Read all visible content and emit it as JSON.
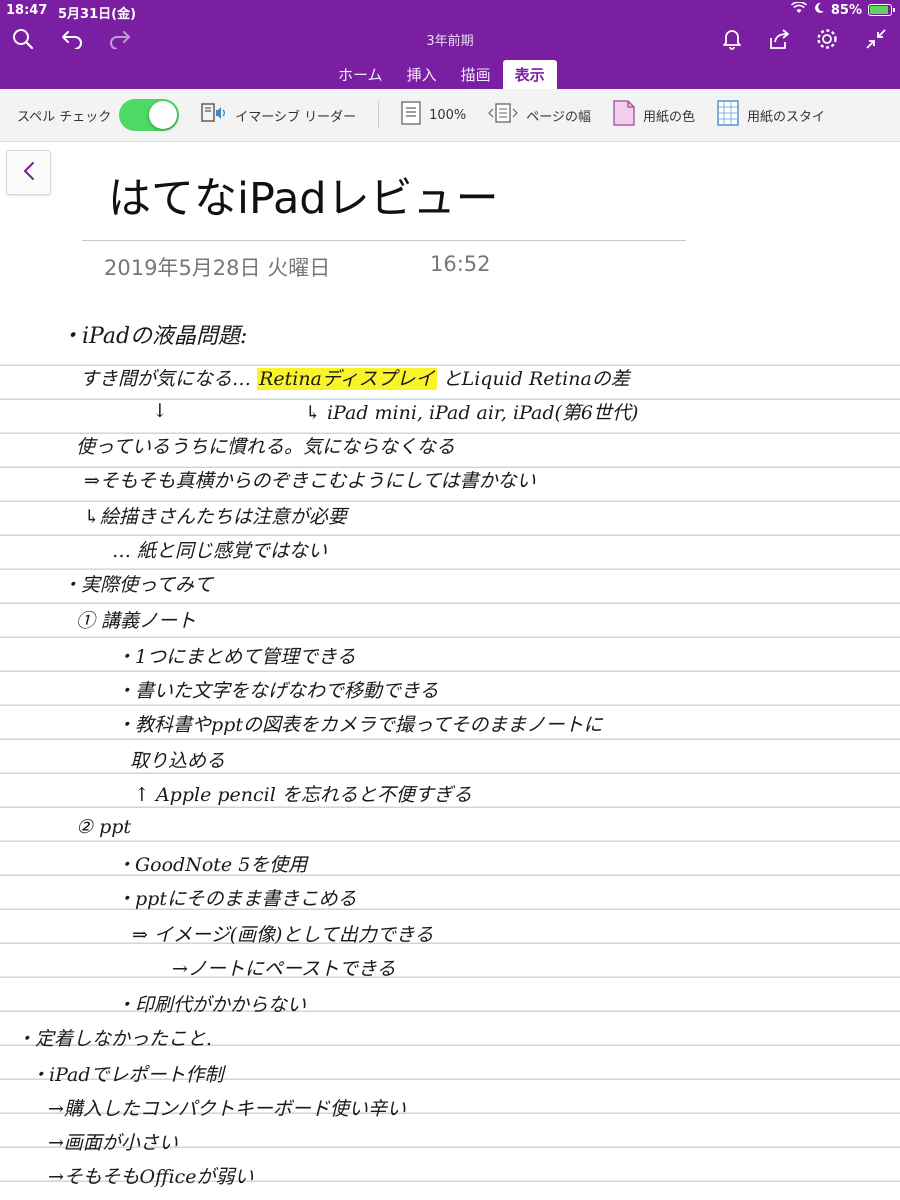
{
  "status": {
    "time": "18:47",
    "date": "5月31日(金)",
    "battery": "85%"
  },
  "header": {
    "notebook": "3年前期"
  },
  "tabs": [
    "ホーム",
    "挿入",
    "描画",
    "表示"
  ],
  "ribbon": {
    "spell_check": "スペル チェック",
    "immersive_reader": "イマーシブ リーダー",
    "zoom": "100%",
    "page_width": "ページの幅",
    "paper_color": "用紙の色",
    "paper_style": "用紙のスタイ"
  },
  "page": {
    "title": "はてなiPadレビュー",
    "date": "2019年5月28日 火曜日",
    "time": "16:52"
  },
  "notes": {
    "l01": "・iPadの液晶問題:",
    "l02a": "すき間が気になる…",
    "l02b": "Retinaディスプレイ",
    "l02c": "とLiquid Retinaの差",
    "l03a": "↓",
    "l03b": "↳ iPad mini, iPad air, iPad(第6世代)",
    "l04": "使っているうちに慣れる。気にならなくなる",
    "l05": "⇒そもそも真横からのぞきこむようにしては書かない",
    "l06": "↳絵描きさんたちは注意が必要",
    "l07": "… 紙と同じ感覚ではない",
    "l08": "・実際使ってみて",
    "l09": "① 講義ノート",
    "l10": "・1つにまとめて管理できる",
    "l11": "・書いた文字をなげなわで移動できる",
    "l12": "・教科書やpptの図表をカメラで撮ってそのままノートに",
    "l13": "取り込める",
    "l14": "↑ Apple pencil を忘れると不便すぎる",
    "l15": "② ppt",
    "l16": "・GoodNote 5を使用",
    "l17": "・pptにそのまま書きこめる",
    "l18": "⇒ イメージ(画像)として出力できる",
    "l19": "→ノートにペーストできる",
    "l20": "・印刷代がかからない",
    "l21": "・定着しなかったこと.",
    "l22": "・iPadでレポート作制",
    "l23": "→購入したコンパクトキーボード使い辛い",
    "l24": "→画面が小さい",
    "l25": "→そもそもOfficeが弱い"
  },
  "colors": {
    "accent": "#7a1fa2",
    "toggle_on": "#4cd964",
    "highlight": "#fbf32a",
    "rule": "#bfd9ee"
  },
  "icons": [
    "search-icon",
    "undo-icon",
    "redo-icon",
    "bell-icon",
    "share-icon",
    "gear-icon",
    "collapse-icon",
    "back-chevron-icon",
    "immersive-reader-icon",
    "zoom-page-icon",
    "page-width-icon",
    "paper-color-icon",
    "paper-style-icon"
  ]
}
